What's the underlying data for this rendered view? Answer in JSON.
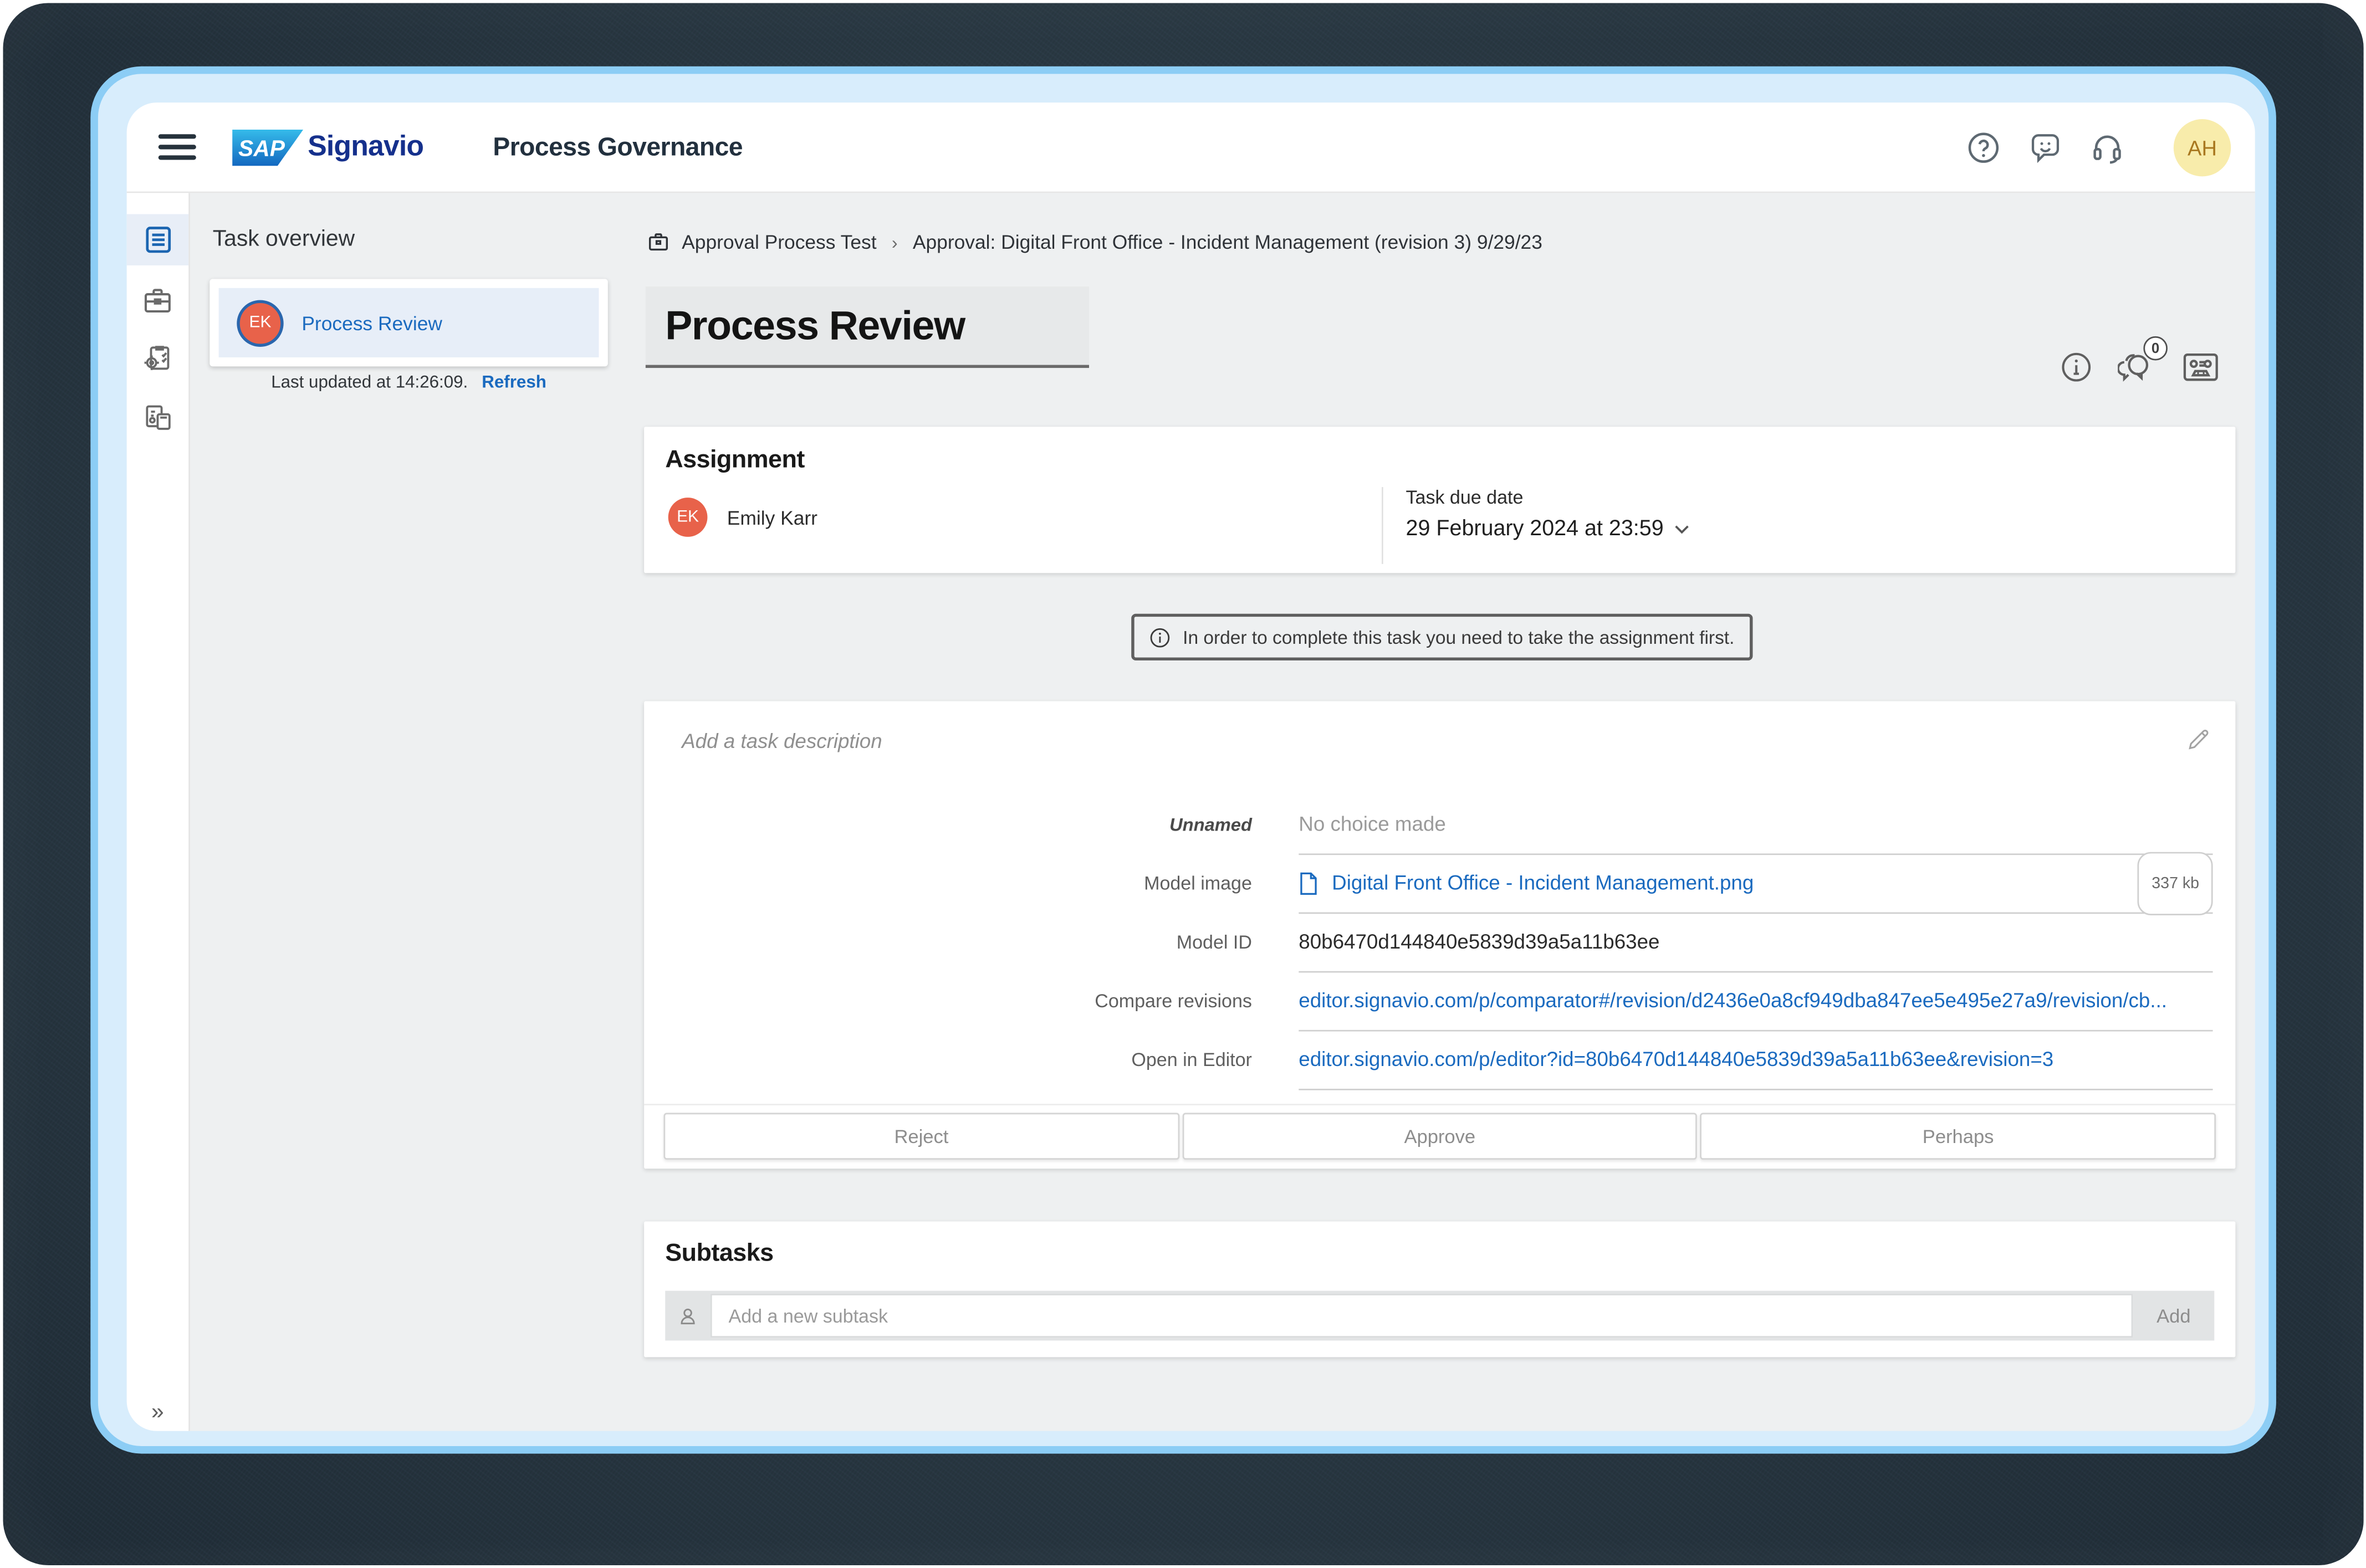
{
  "topbar": {
    "brand": "SAP",
    "product": "Signavio",
    "app_title": "Process Governance",
    "avatar_initials": "AH"
  },
  "task_overview": {
    "title": "Task overview",
    "task": {
      "initials": "EK",
      "label": "Process Review"
    },
    "last_updated": "Last updated at 14:26:09.",
    "refresh_label": "Refresh"
  },
  "breadcrumb": {
    "parent": "Approval Process Test",
    "separator": "›",
    "current": "Approval: Digital Front Office - Incident Management (revision 3) 9/29/23"
  },
  "page": {
    "title": "Process Review",
    "comments_count": "0"
  },
  "assignment": {
    "heading": "Assignment",
    "assignee": {
      "initials": "EK",
      "name": "Emily Karr"
    },
    "due": {
      "label": "Task due date",
      "value": "29 February 2024 at 23:59"
    }
  },
  "notice": {
    "text": "In order to complete this task you need to take the assignment first."
  },
  "details": {
    "description_placeholder": "Add a task description",
    "fields": [
      {
        "label": "Unnamed",
        "value": "No choice made"
      },
      {
        "label": "Model image",
        "value": "Digital Front Office - Incident Management.png",
        "size": "337 kb"
      },
      {
        "label": "Model ID",
        "value": "80b6470d144840e5839d39a5a11b63ee"
      },
      {
        "label": "Compare revisions",
        "value": "editor.signavio.com/p/comparator#/revision/d2436e0a8cf949dba847ee5e495e27a9/revision/cb..."
      },
      {
        "label": "Open in Editor",
        "value": "editor.signavio.com/p/editor?id=80b6470d144840e5839d39a5a11b63ee&revision=3"
      }
    ],
    "actions": {
      "reject": "Reject",
      "approve": "Approve",
      "perhaps": "Perhaps"
    }
  },
  "subtasks": {
    "heading": "Subtasks",
    "input_placeholder": "Add a new subtask",
    "add_label": "Add"
  },
  "sidebar": {
    "collapse_glyph": "»",
    "icons": [
      "task-list-icon",
      "briefcase-icon",
      "process-settings-icon",
      "reports-icon"
    ]
  },
  "colors": {
    "link_blue": "#1a6abf",
    "active_icon_blue": "#1b65b1",
    "assignee_avatar": "#e8624a",
    "user_avatar_bg": "#f8ecab",
    "frame_blue": "#8ccdf5",
    "page_bg": "#eef0f1"
  }
}
